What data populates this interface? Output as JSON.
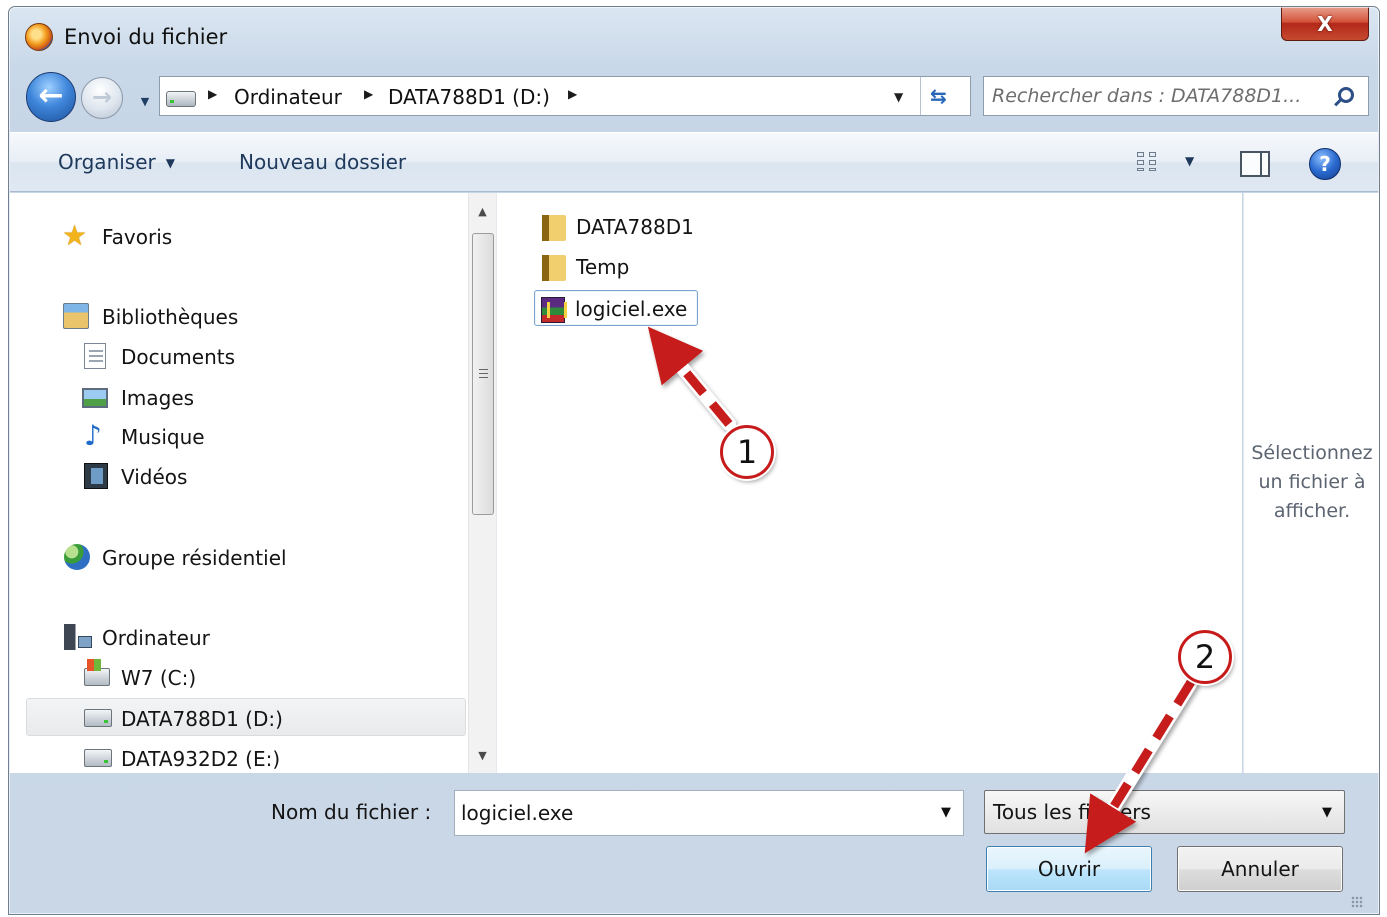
{
  "window": {
    "title": "Envoi du fichier",
    "close_label": "X"
  },
  "address_bar": {
    "breadcrumbs": [
      "Ordinateur",
      "DATA788D1 (D:)"
    ],
    "search_placeholder": "Rechercher dans : DATA788D1..."
  },
  "commandbar": {
    "organize": "Organiser",
    "new_folder": "Nouveau dossier"
  },
  "navigation": {
    "favorites": "Favoris",
    "libraries": "Bibliothèques",
    "documents": "Documents",
    "images": "Images",
    "music": "Musique",
    "videos": "Vidéos",
    "homegroup": "Groupe résidentiel",
    "computer": "Ordinateur",
    "drive_c": "W7 (C:)",
    "drive_d": "DATA788D1 (D:)",
    "drive_e": "DATA932D2 (E:)"
  },
  "files": [
    {
      "name": "DATA788D1",
      "type": "folder"
    },
    {
      "name": "Temp",
      "type": "folder"
    },
    {
      "name": "logiciel.exe",
      "type": "exe"
    }
  ],
  "preview": {
    "message": "Sélectionnez un fichier à afficher."
  },
  "bottom": {
    "filename_label": "Nom du fichier :",
    "filename_value": "logiciel.exe",
    "filetype_value": "Tous les fichiers",
    "open_label": "Ouvrir",
    "cancel_label": "Annuler"
  },
  "annotations": {
    "step1": "1",
    "step2": "2",
    "arrow_color": "#c71b1b"
  }
}
